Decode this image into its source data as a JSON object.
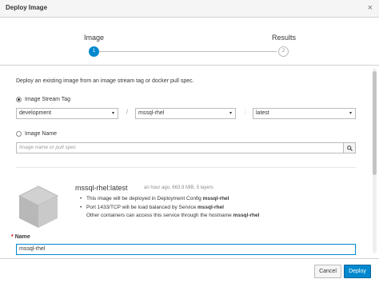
{
  "dialog": {
    "title": "Deploy Image",
    "close_glyph": "×"
  },
  "wizard": {
    "steps": [
      {
        "label": "Image",
        "number": "1",
        "active": true
      },
      {
        "label": "Results",
        "number": "2",
        "active": false
      }
    ]
  },
  "form": {
    "intro": "Deploy an existing image from an image stream tag or docker pull spec.",
    "stream_tag_option": "Image Stream Tag",
    "namespace_value": "development",
    "separator_slash": "/",
    "stream_value": "mssql-rhel",
    "separator_colon": ":",
    "tag_value": "latest",
    "image_name_option": "Image Name",
    "image_name_placeholder": "Image name or pull spec",
    "selected_option": "Image Stream Tag"
  },
  "image_info": {
    "title": "mssql-rhel:latest",
    "meta": "an hour ago, 663.9 MiB, 5 layers",
    "line1_prefix": "This image will be deployed in Deployment Config ",
    "line1_bold": "mssql-rhel",
    "line2_prefix": "Port 1433/TCP will be load balanced by Service ",
    "line2_bold": "mssql-rhel",
    "line3_prefix": "Other containers can access this service through the hostname ",
    "line3_bold": "mssql-rhel"
  },
  "name_field": {
    "required_mark": "*",
    "label": "Name",
    "value": "mssql-rhel"
  },
  "footer": {
    "cancel_label": "Cancel",
    "deploy_label": "Deploy"
  },
  "icons": {
    "search": "search-icon",
    "close": "close-icon",
    "caret": "caret-down-icon",
    "image": "cube-icon"
  },
  "colors": {
    "accent": "#0088ce",
    "border": "#bbbbbb",
    "text": "#363636",
    "muted": "#8b8d8f"
  }
}
